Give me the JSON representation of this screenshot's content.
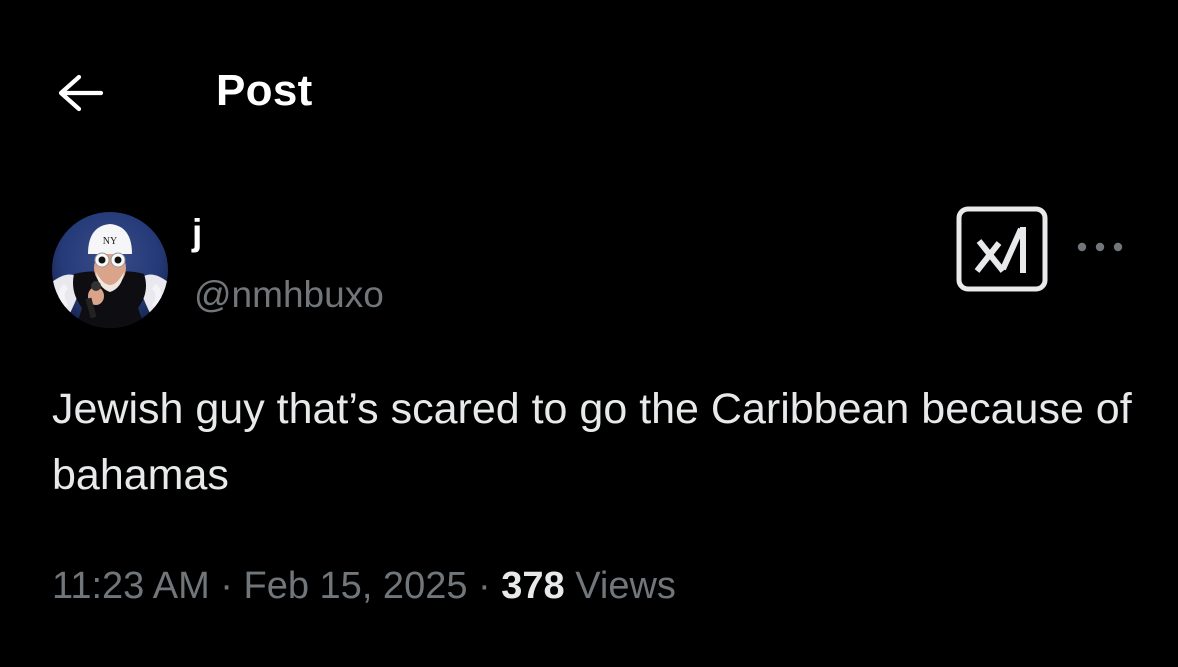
{
  "header": {
    "back_icon": "arrow-left-icon",
    "title": "Post"
  },
  "author": {
    "avatar_icon": "avatar-image",
    "display_name": "j",
    "handle": "@nmhbuxo"
  },
  "actions": {
    "grok_icon": "grok-logo-icon",
    "more_icon": "more-horizontal-icon"
  },
  "tweet": {
    "text": "Jewish guy that’s scared to go the Caribbean because of bahamas"
  },
  "meta": {
    "time": "11:23 AM",
    "separator": "·",
    "date": "Feb 15, 2025",
    "views_count": "378",
    "views_label": "Views"
  },
  "colors": {
    "background": "#000000",
    "primary_text": "#e7e9ea",
    "secondary_text": "#71767b"
  }
}
